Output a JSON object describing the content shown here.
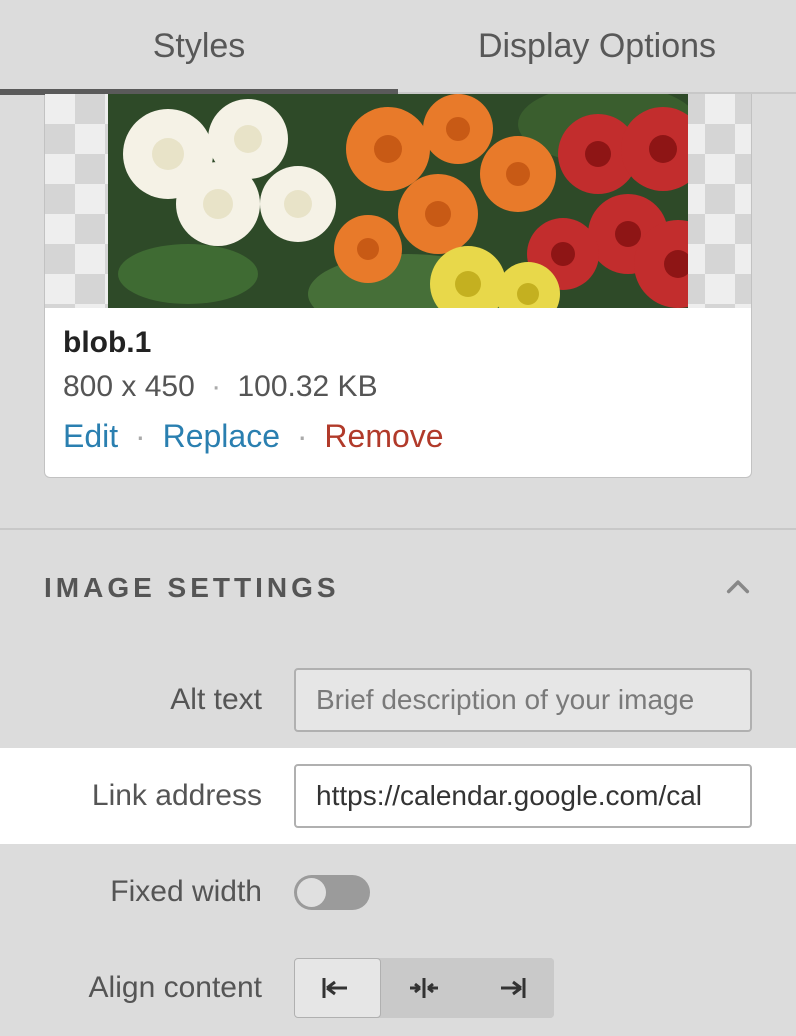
{
  "tabs": {
    "styles": "Styles",
    "display_options": "Display Options",
    "active": "styles"
  },
  "image": {
    "name": "blob.1",
    "dimensions": "800 x 450",
    "size": "100.32 KB",
    "actions": {
      "edit": "Edit",
      "replace": "Replace",
      "remove": "Remove"
    }
  },
  "section": {
    "title": "IMAGE SETTINGS"
  },
  "settings": {
    "alt_text": {
      "label": "Alt text",
      "placeholder": "Brief description of your image",
      "value": ""
    },
    "link_address": {
      "label": "Link address",
      "value": "https://calendar.google.com/cal"
    },
    "fixed_width": {
      "label": "Fixed width",
      "value": false
    },
    "align_content": {
      "label": "Align content",
      "value": "left"
    }
  }
}
